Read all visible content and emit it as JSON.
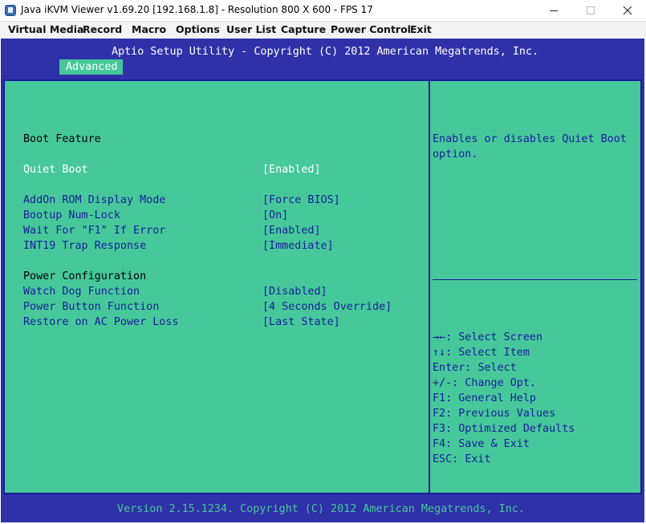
{
  "window": {
    "title": "Java iKVM Viewer v1.69.20 [192.168.1.8]  - Resolution 800 X 600 - FPS 17",
    "controls": [
      "minimize",
      "maximize",
      "close"
    ]
  },
  "menubar": {
    "items": [
      "Virtual Media",
      "Record",
      "Macro",
      "Options",
      "User List",
      "Capture",
      "Power Control",
      "Exit"
    ]
  },
  "bios": {
    "title": "Aptio Setup Utility - Copyright (C) 2012 American Megatrends, Inc.",
    "active_tab": "Advanced",
    "sections": [
      {
        "header": "Boot Feature"
      },
      {
        "label": "Quiet Boot",
        "value": "[Enabled]",
        "selected": true
      },
      {
        "label": "AddOn ROM Display Mode",
        "value": "[Force BIOS]"
      },
      {
        "label": "Bootup Num-Lock",
        "value": "[On]"
      },
      {
        "label": "Wait For \"F1\" If Error",
        "value": "[Enabled]"
      },
      {
        "label": "INT19 Trap Response",
        "value": "[Immediate]"
      },
      {
        "header": "Power Configuration"
      },
      {
        "label": "Watch Dog Function",
        "value": "[Disabled]"
      },
      {
        "label": "Power Button Function",
        "value": "[4 Seconds Override]"
      },
      {
        "label": "Restore on AC Power Loss",
        "value": "[Last State]"
      }
    ],
    "help_line1": "Enables or disables Quiet Boot",
    "help_line2": "option.",
    "keys": [
      {
        "key": "→←:",
        "action": "Select Screen"
      },
      {
        "key": "↑↓:",
        "action": "Select Item"
      },
      {
        "key": "Enter:",
        "action": "Select"
      },
      {
        "key": "+/-:",
        "action": "Change Opt."
      },
      {
        "key": "F1:",
        "action": "General Help"
      },
      {
        "key": "F2:",
        "action": "Previous Values"
      },
      {
        "key": "F3:",
        "action": "Optimized Defaults"
      },
      {
        "key": "F4:",
        "action": "Save & Exit"
      },
      {
        "key": "ESC:",
        "action": "Exit"
      }
    ],
    "footer": "Version 2.15.1234. Copyright (C) 2012 American Megatrends, Inc."
  },
  "colors": {
    "bios_blue": "#2f31a8",
    "panel_green": "#46c89b",
    "option_text": "#1a1d9a",
    "selected_text": "#ffffff"
  }
}
